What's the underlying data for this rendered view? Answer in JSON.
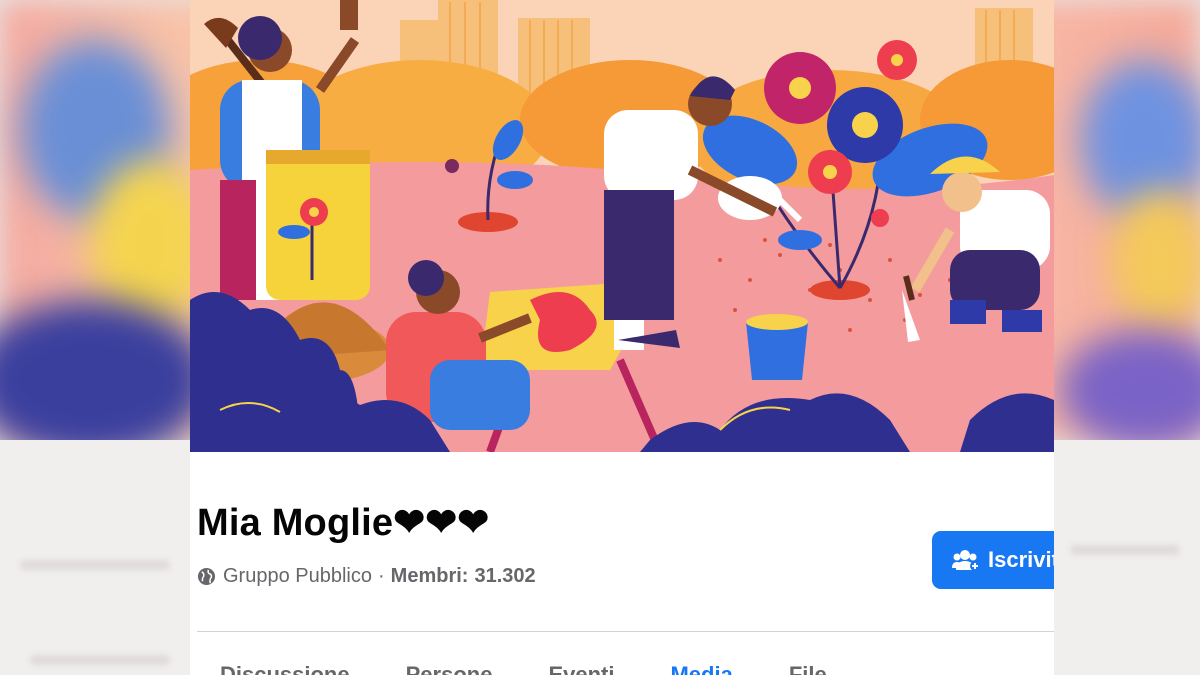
{
  "group": {
    "name": "Mia Moglie❤❤❤",
    "privacy_label": "Gruppo Pubblico",
    "separator": "·",
    "members_label": "Membri:",
    "members_count": "31.302"
  },
  "actions": {
    "join_label": "Iscriviti",
    "join_icon": "add-group-icon"
  },
  "tabs": [
    {
      "label": "Discussione",
      "active": false
    },
    {
      "label": "Persone",
      "active": false
    },
    {
      "label": "Eventi",
      "active": false
    },
    {
      "label": "Media",
      "active": true
    },
    {
      "label": "File",
      "active": false
    }
  ],
  "colors": {
    "accent": "#1877f2",
    "title_text": "#050505",
    "meta_text": "#65676b"
  }
}
